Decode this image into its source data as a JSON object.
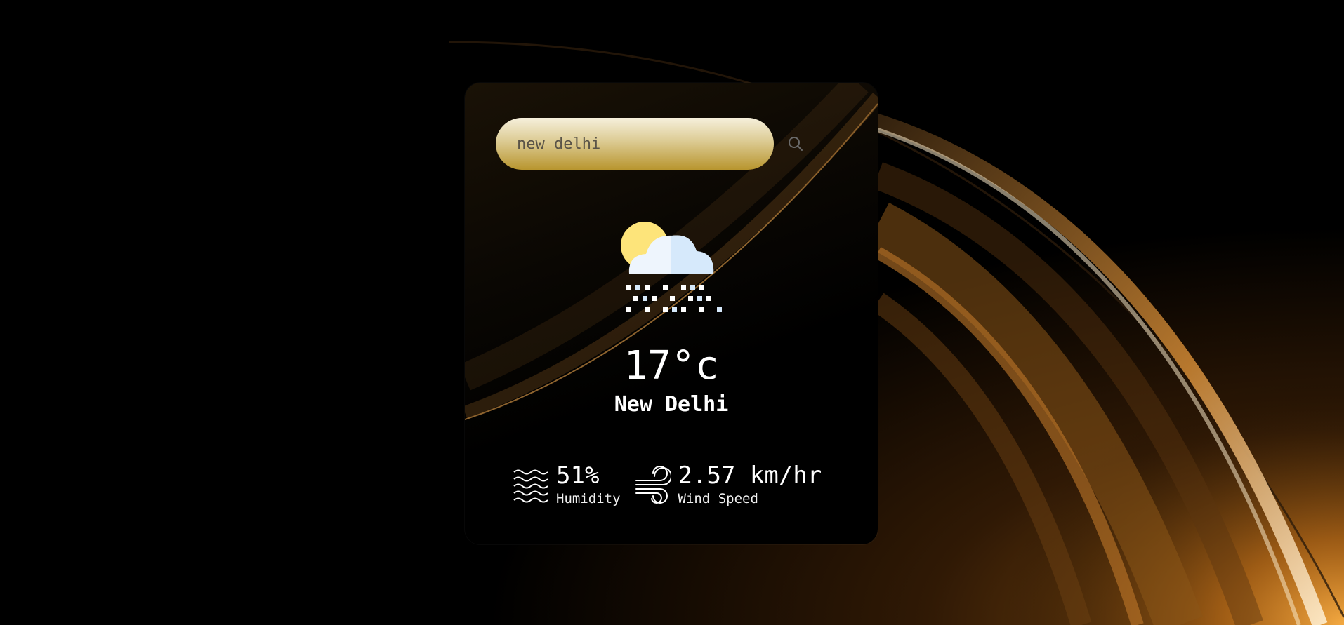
{
  "search": {
    "value": "new delhi",
    "button_icon": "search-icon"
  },
  "weather": {
    "icon": "partly-cloudy-snow-icon",
    "temperature": "17°c",
    "city": "New Delhi"
  },
  "stats": {
    "humidity": {
      "icon": "humidity-waves-icon",
      "value": "51%",
      "label": "Humidity"
    },
    "wind": {
      "icon": "wind-icon",
      "value": "2.57 km/hr",
      "label": "Wind Speed"
    }
  },
  "colors": {
    "background": "#000000",
    "accent_gold": "#b8952e",
    "sun": "#fde47a",
    "cloud": "#eef5fd",
    "text": "#ffffff"
  }
}
